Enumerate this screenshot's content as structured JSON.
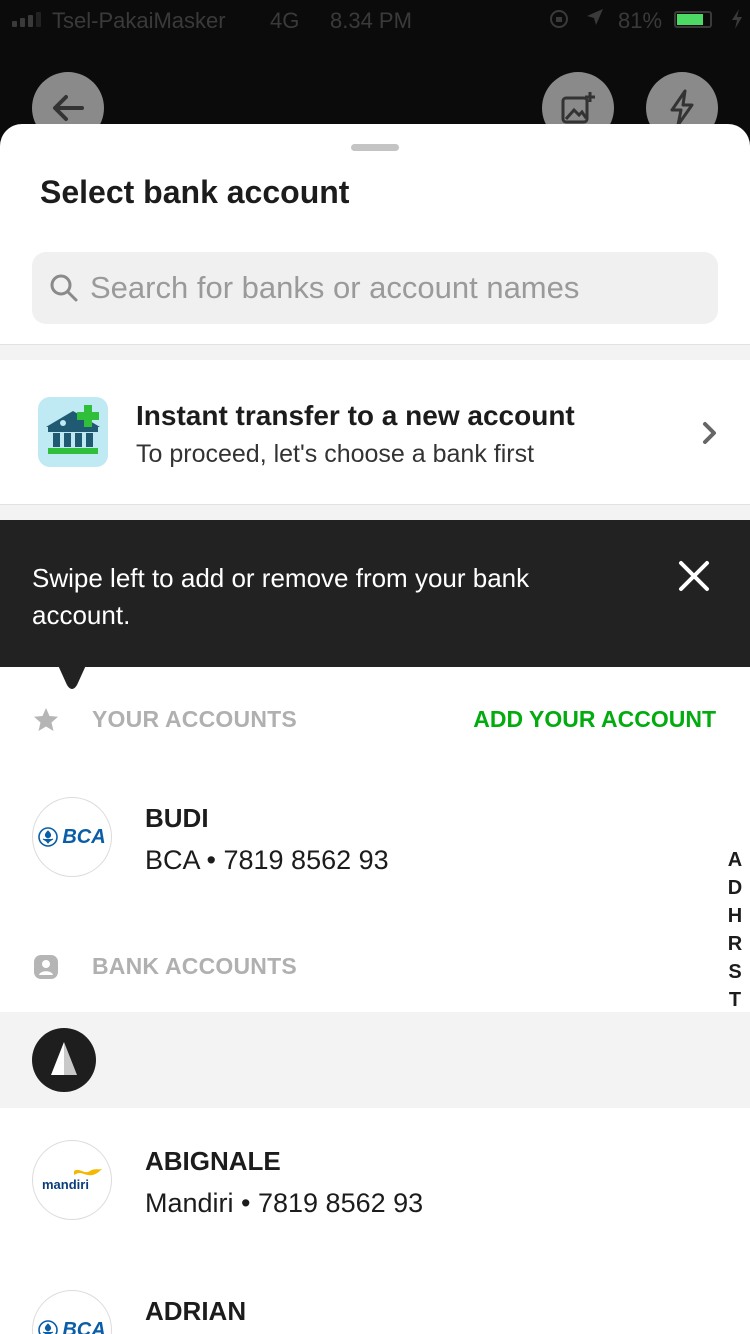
{
  "status_bar": {
    "carrier": "Tsel-PakaiMasker",
    "network": "4G",
    "time": "8.34 PM",
    "battery": "81%",
    "battery_level": 0.81,
    "battery_color": "#4cd964"
  },
  "sheet": {
    "title": "Select bank account",
    "search_placeholder": "Search for banks or account names"
  },
  "instant_transfer": {
    "title": "Instant transfer to a new account",
    "subtitle": "To proceed, let's choose a bank first"
  },
  "tooltip": {
    "message": "Swipe left to add or remove from your bank account."
  },
  "your_accounts": {
    "label": "YOUR ACCOUNTS",
    "add_label": "ADD YOUR ACCOUNT",
    "items": [
      {
        "name": "BUDI",
        "detail": "BCA • 7819 8562 93",
        "bank": "BCA"
      }
    ]
  },
  "bank_accounts": {
    "label": "BANK ACCOUNTS",
    "items": [
      {
        "name": "ABIGNALE",
        "detail": "Mandiri • 7819 8562 93",
        "bank": "mandiri"
      },
      {
        "name": "ADRIAN",
        "detail": "",
        "bank": "BCA"
      }
    ]
  },
  "alpha_index": [
    "A",
    "D",
    "H",
    "R",
    "S",
    "T"
  ],
  "colors": {
    "accent_green": "#03ac0e",
    "tooltip_bg": "#222222",
    "bca_blue": "#0a5ea8",
    "mandiri_yellow": "#f5b800"
  }
}
